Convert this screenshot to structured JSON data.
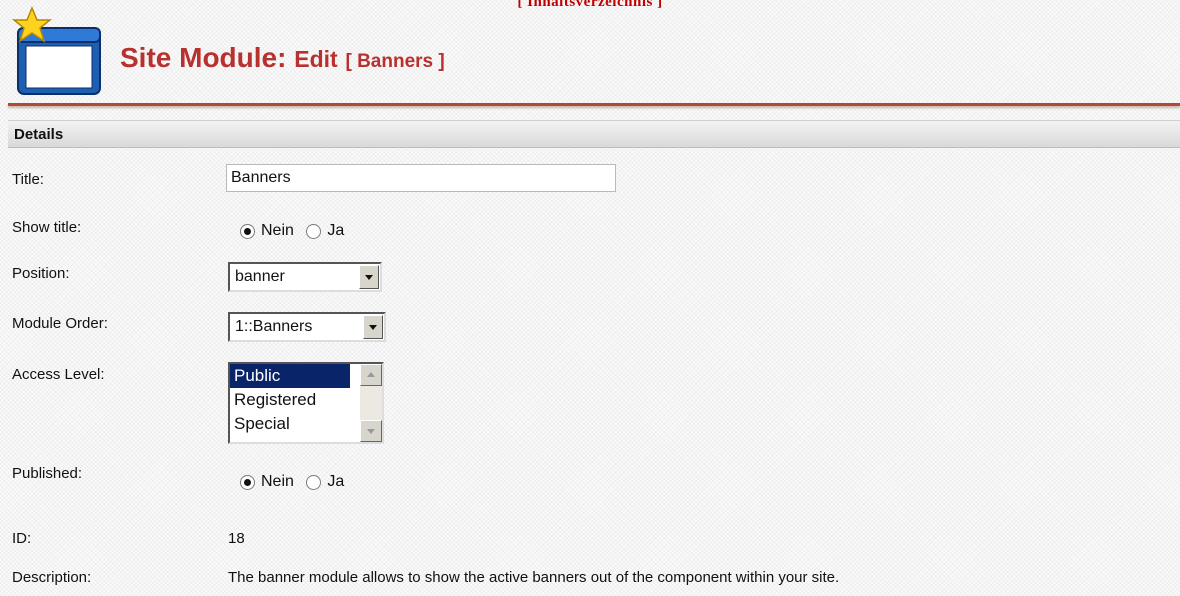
{
  "top_link": "[ Inhaltsverzeichnis ]",
  "header": {
    "title_main": "Site Module:",
    "title_action": "Edit",
    "title_bracket": "[ Banners ]",
    "icon": "module-window-star-icon"
  },
  "section": {
    "title": "Details"
  },
  "form": {
    "title_label": "Title:",
    "title_value": "Banners",
    "show_title_label": "Show title:",
    "show_title_options": [
      "Nein",
      "Ja"
    ],
    "show_title_selected": "Nein",
    "position_label": "Position:",
    "position_value": "banner",
    "order_label": "Module Order:",
    "order_value": "1::Banners",
    "access_label": "Access Level:",
    "access_options": [
      "Public",
      "Registered",
      "Special"
    ],
    "access_selected": "Public",
    "published_label": "Published:",
    "published_options": [
      "Nein",
      "Ja"
    ],
    "published_selected": "Nein",
    "id_label": "ID:",
    "id_value": "18",
    "description_label": "Description:",
    "description_value": "The banner module allows to show the active banners out of the component within your site."
  },
  "colors": {
    "title_red": "#b8312f",
    "rule": "#b24a33",
    "link_red": "#c00000",
    "selection": "#0a246a"
  }
}
